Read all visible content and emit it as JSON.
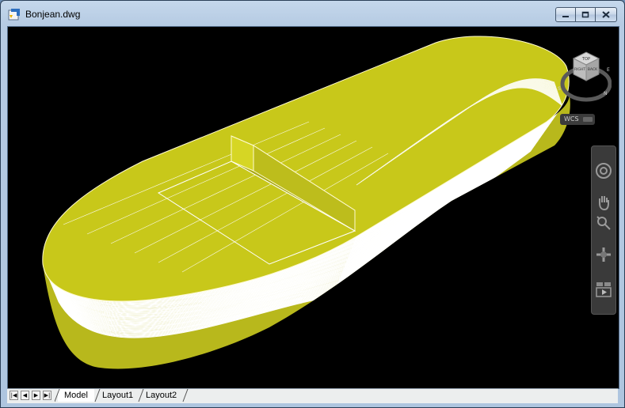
{
  "window": {
    "title": "Bonjean.dwg"
  },
  "layout_tabs": [
    {
      "label": "Model",
      "active": true
    },
    {
      "label": "Layout1",
      "active": false
    },
    {
      "label": "Layout2",
      "active": false
    }
  ],
  "viewcube": {
    "top_face": "TOP",
    "right_face": "BACK",
    "left_face": "RIGHT",
    "compass_n": "N",
    "compass_w": "W",
    "compass_s": "S",
    "compass_e": "E"
  },
  "wcs_menu": {
    "label": "WCS"
  },
  "colors": {
    "viewport_bg": "#000000",
    "hull_fill": "#c8c81a",
    "hull_lines": "#ffffff"
  },
  "navigation_bar": {
    "tools": [
      "steering-wheel-icon",
      "pan-icon",
      "zoom-icon",
      "orbit-icon",
      "showmotion-icon"
    ]
  }
}
